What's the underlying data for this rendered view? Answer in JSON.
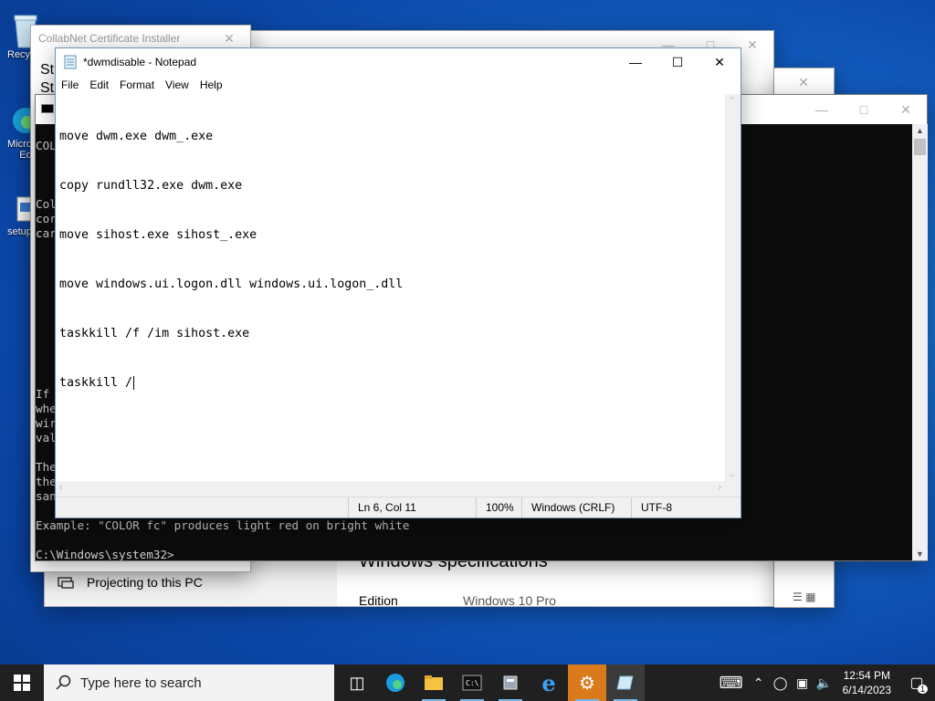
{
  "desktop": {
    "icons": [
      {
        "label": "Recy"
      },
      {
        "label": "Micro"
      },
      {
        "label": "Ed"
      },
      {
        "label": "setup"
      }
    ]
  },
  "collabnet_window": {
    "title": "CollabNet Certificate Installer",
    "body_lines": [
      "St",
      "St"
    ]
  },
  "settings_window": {
    "projecting_label": "Projecting to this PC",
    "specs_heading": "Windows specifications",
    "edition_label": "Edition",
    "edition_value": "Windows 10 Pro"
  },
  "cmd_window": {
    "left_fragments": [
      "COL",
      "Col",
      "cor",
      "car",
      "If",
      "whe",
      "wir",
      "val",
      "The",
      "the",
      "san"
    ],
    "example_line": "Example: \"COLOR fc\" produces light red on bright white",
    "prompt": "C:\\Windows\\system32>"
  },
  "notepad": {
    "title": "*dwmdisable - Notepad",
    "menu": [
      "File",
      "Edit",
      "Format",
      "View",
      "Help"
    ],
    "lines": [
      "move dwm.exe dwm_.exe",
      "copy rundll32.exe dwm.exe",
      "move sihost.exe sihost_.exe",
      "move windows.ui.logon.dll windows.ui.logon_.dll",
      "taskkill /f /im sihost.exe",
      "taskkill /"
    ],
    "status": {
      "position": "Ln 6, Col 11",
      "zoom": "100%",
      "line_ending": "Windows (CRLF)",
      "encoding": "UTF-8"
    }
  },
  "taskbar": {
    "search_placeholder": "Type here to search",
    "time": "12:54 PM",
    "date": "6/14/2023",
    "notification_count": "1",
    "pinned": [
      "task-view-icon",
      "edge-icon",
      "file-explorer-icon",
      "cmd-icon",
      "network-tool-icon",
      "ie-icon",
      "settings-icon",
      "notepad-icon"
    ]
  }
}
